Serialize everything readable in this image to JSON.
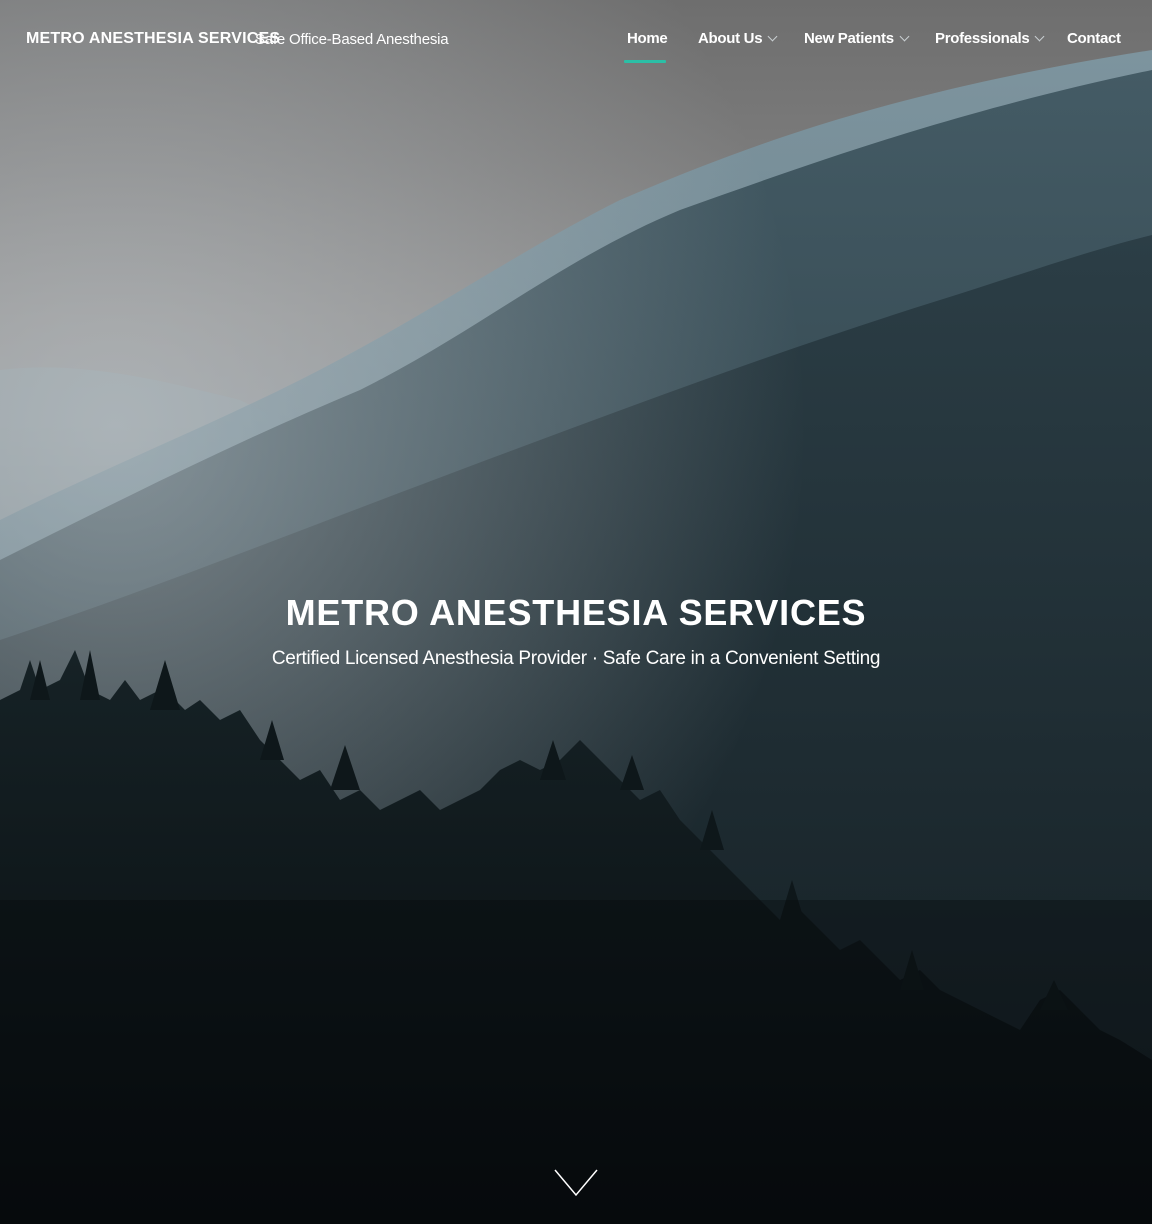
{
  "header": {
    "brand": "METRO ANESTHESIA SERVICES",
    "tagline": "Safe Office-Based Anesthesia"
  },
  "nav": {
    "items": [
      {
        "label": "Home",
        "active": true,
        "has_dropdown": false
      },
      {
        "label": "About Us",
        "active": false,
        "has_dropdown": true
      },
      {
        "label": "New Patients",
        "active": false,
        "has_dropdown": true
      },
      {
        "label": "Professionals",
        "active": false,
        "has_dropdown": true
      },
      {
        "label": "Contact",
        "active": false,
        "has_dropdown": false
      }
    ],
    "active_color": "#2bbfa6"
  },
  "hero": {
    "title": "METRO ANESTHESIA SERVICES",
    "subtitle": "Certified Licensed Anesthesia Provider · Safe Care in a Convenient Setting",
    "background": "misty-forest-mountains",
    "scroll_icon": "chevron-down-icon"
  }
}
